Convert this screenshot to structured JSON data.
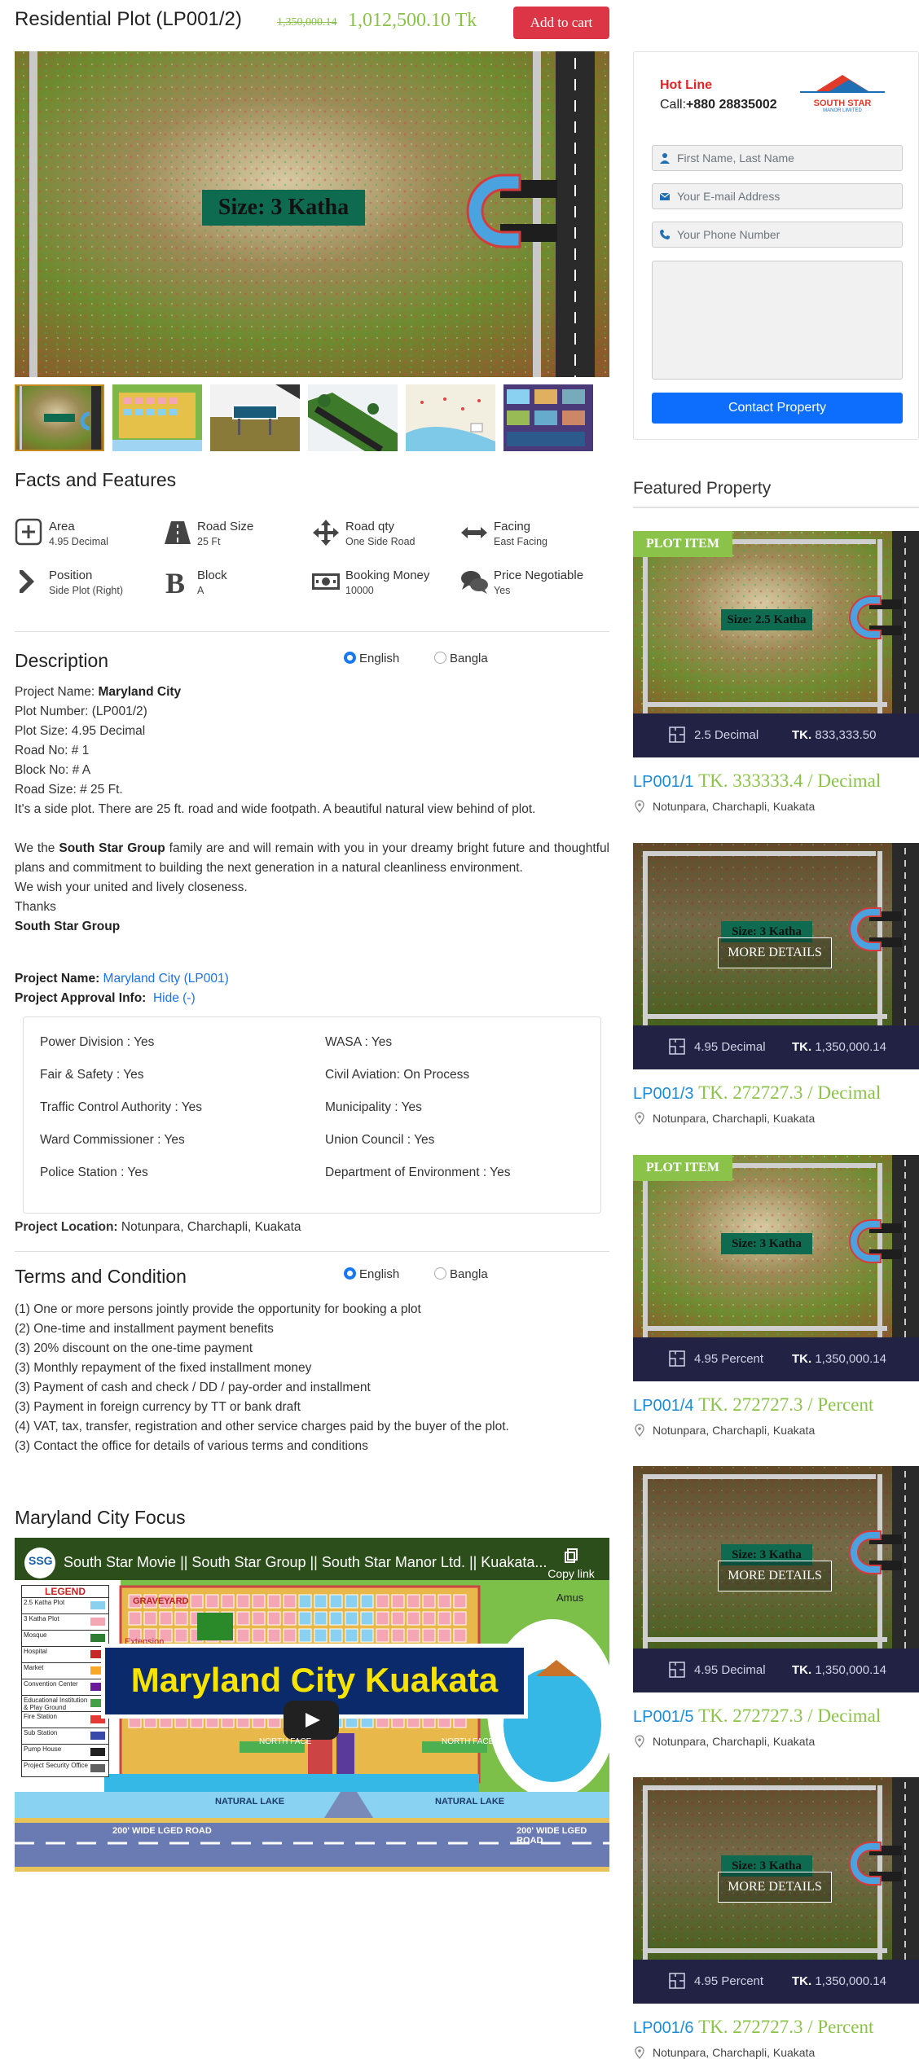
{
  "header": {
    "title": "Residential Plot (LP001/2)",
    "old_price": "1,350,000.14",
    "new_price": "1,012,500.10 Tk",
    "cart_label": "Add to cart"
  },
  "hero": {
    "size_label": "Size: 3 Katha"
  },
  "facts": {
    "title": "Facts and Features",
    "items": [
      {
        "label": "Area",
        "value": "4.95 Decimal",
        "icon": "plus-box-icon"
      },
      {
        "label": "Road Size",
        "value": "25 Ft",
        "icon": "road-icon"
      },
      {
        "label": "Road qty",
        "value": "One Side Road",
        "icon": "arrows-cross-icon"
      },
      {
        "label": "Facing",
        "value": "East Facing",
        "icon": "arrows-horizontal-icon"
      },
      {
        "label": "Position",
        "value": "Side Plot (Right)",
        "icon": "chevron-right-icon"
      },
      {
        "label": "Block",
        "value": "A",
        "icon": "letter-b-icon"
      },
      {
        "label": "Booking Money",
        "value": "10000",
        "icon": "money-icon"
      },
      {
        "label": "Price Negotiable",
        "value": "Yes",
        "icon": "chat-bubbles-icon"
      }
    ]
  },
  "description": {
    "title": "Description",
    "lang_english": "English",
    "lang_bangla": "Bangla",
    "project_name_label": "Project Name:",
    "project_name": "Maryland City",
    "plot_number": "Plot Number: (LP001/2)",
    "plot_size": "Plot Size: 4.95 Decimal",
    "road_no": "Road No: # 1",
    "block_no": "Block No: # A",
    "road_size": "Road Size: # 25 Ft.",
    "side_note": "It's a side plot. There are 25 ft. road and wide footpath. A beautiful natural view behind of plot.",
    "para_we_the": "We the",
    "para_group": "South Star Group",
    "para_rest": "family are and will remain with you in your dreamy bright future and thoughtful plans and commitment to building the next generation in a natural cleanliness environment.",
    "wish": "We wish your united and lively closeness.",
    "thanks": "Thanks",
    "sign": "South Star Group",
    "project_link_label": "Project Name:",
    "project_link": "Maryland City (LP001)",
    "approval_label": "Project Approval Info:",
    "approval_toggle": "Hide (-)",
    "approvals": [
      "Power Division : Yes",
      "WASA : Yes",
      "Fair & Safety : Yes",
      "Civil Aviation: On Process",
      "Traffic Control Authority : Yes",
      "Municipality : Yes",
      "Ward Commissioner : Yes",
      "Union Council : Yes",
      "Police Station : Yes",
      "Department of Environment : Yes"
    ],
    "location_label": "Project Location:",
    "location": "Notunpara, Charchapli, Kuakata"
  },
  "terms": {
    "title": "Terms and Condition",
    "lang_english": "English",
    "lang_bangla": "Bangla",
    "lines": [
      "(1) One or more persons jointly provide the opportunity for booking a plot",
      "(2) One-time and installment payment benefits",
      "(3) 20% discount on the one-time payment",
      "(3) Monthly repayment of the fixed installment money",
      "(3) Payment of cash and check / DD / pay-order and installment",
      "(3) Payment in foreign currency by TT or bank draft",
      "(4) VAT, tax, transfer, registration and other service charges paid by the buyer of the plot.",
      "(3) Contact the office for details of various terms and conditions"
    ]
  },
  "focus": {
    "title": "Maryland City Focus",
    "video_title": "South Star Movie || South Star Group || South Star Manor Ltd. || Kuakata...",
    "copy_link": "Copy link",
    "banner": "Maryland City Kuakata",
    "legend_title": "LEGEND",
    "legend_items": [
      "2.5 Katha Plot",
      "3 Katha Plot",
      "Mosque",
      "Hospital",
      "Market",
      "Convention Center",
      "Educational Institution & Play Ground",
      "Fire Station",
      "Sub Station",
      "Pump House",
      "Project Security Office"
    ],
    "road_label": "200' WIDE LGED ROAD",
    "lake_label": "NATURAL LAKE",
    "north_face": "NORTH FACE",
    "graveyard": "GRAVEYARD",
    "extension": "Extension",
    "amusement": "Amus",
    "logo_letters": "SSG",
    "logo_sub": "SOUTH STAR"
  },
  "contact": {
    "hotline_label": "Hot Line",
    "call_prefix": "Call:",
    "phone": "+880 28835002",
    "logo_text": "SOUTH STAR",
    "logo_sub": "MANOR LIMITED",
    "name_placeholder": "First Name, Last Name",
    "email_placeholder": "Your E-mail Address",
    "phone_placeholder": "Your Phone Number",
    "button": "Contact Property"
  },
  "featured": {
    "title": "Featured Property",
    "badge": "PLOT ITEM",
    "more": "MORE DETAILS",
    "tk_label": "TK.",
    "cards": [
      {
        "size": "2.5 Decimal",
        "tk": "833,333.50",
        "code": "LP001/1",
        "price": "TK. 333333.4 / Decimal",
        "location": "Notunpara, Charchapli, Kuakata",
        "img_label": "Size: 2.5 Katha"
      },
      {
        "size": "4.95 Decimal",
        "tk": "1,350,000.14",
        "code": "LP001/3",
        "price": "TK. 272727.3 / Decimal",
        "location": "Notunpara, Charchapli, Kuakata",
        "img_label": "Size: 3 Katha"
      },
      {
        "size": "4.95 Percent",
        "tk": "1,350,000.14",
        "code": "LP001/4",
        "price": "TK. 272727.3 / Percent",
        "location": "Notunpara, Charchapli, Kuakata",
        "img_label": "Size: 3 Katha"
      },
      {
        "size": "4.95 Decimal",
        "tk": "1,350,000.14",
        "code": "LP001/5",
        "price": "TK. 272727.3 / Decimal",
        "location": "Notunpara, Charchapli, Kuakata",
        "img_label": "Size: 3 Katha"
      },
      {
        "size": "4.95 Percent",
        "tk": "1,350,000.14",
        "code": "LP001/6",
        "price": "TK. 272727.3 / Percent",
        "location": "Notunpara, Charchapli, Kuakata",
        "img_label": "Size: 3 Katha"
      }
    ]
  },
  "colors": {
    "accent_green": "#8bc34a",
    "link_blue": "#1a73e8",
    "danger": "#dc3545",
    "primary": "#0d6efd",
    "card_bar": "#222244"
  }
}
